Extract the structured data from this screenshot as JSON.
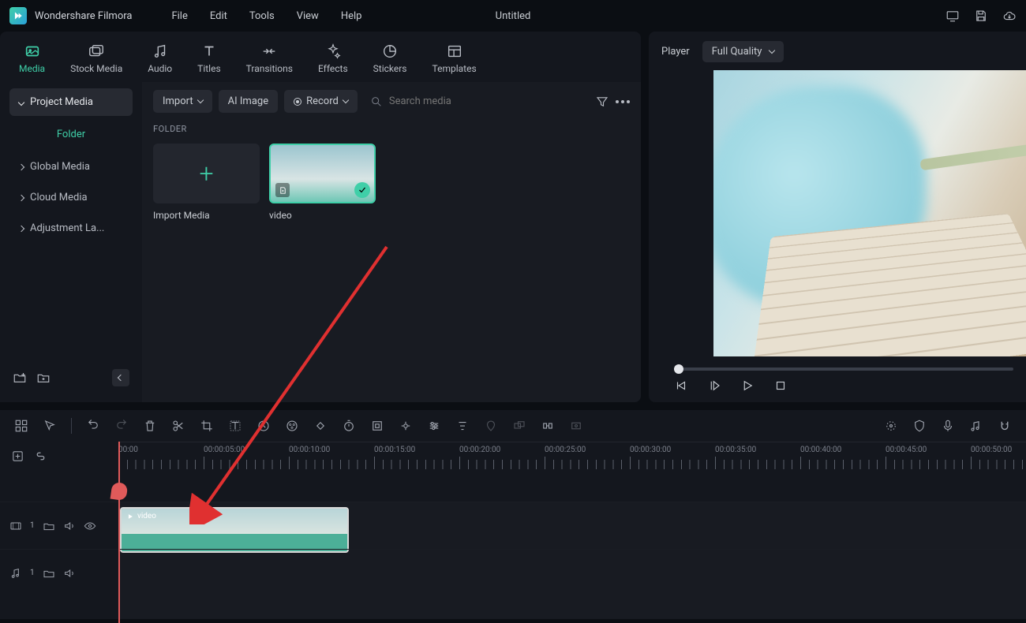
{
  "app": {
    "title": "Wondershare Filmora",
    "project": "Untitled"
  },
  "menu": [
    "File",
    "Edit",
    "Tools",
    "View",
    "Help"
  ],
  "tabs": [
    {
      "id": "media",
      "label": "Media"
    },
    {
      "id": "stock",
      "label": "Stock Media"
    },
    {
      "id": "audio",
      "label": "Audio"
    },
    {
      "id": "titles",
      "label": "Titles"
    },
    {
      "id": "transitions",
      "label": "Transitions"
    },
    {
      "id": "effects",
      "label": "Effects"
    },
    {
      "id": "stickers",
      "label": "Stickers"
    },
    {
      "id": "templates",
      "label": "Templates"
    }
  ],
  "sidebar": {
    "items": [
      {
        "label": "Project Media",
        "selected": true
      },
      {
        "label": "Global Media"
      },
      {
        "label": "Cloud Media"
      },
      {
        "label": "Adjustment La..."
      }
    ],
    "folder_label": "Folder"
  },
  "toolbar": {
    "import": "Import",
    "ai_image": "AI Image",
    "record": "Record",
    "search_placeholder": "Search media"
  },
  "content": {
    "section": "FOLDER",
    "import_label": "Import Media",
    "clip_name": "video"
  },
  "player": {
    "label": "Player",
    "quality": "Full Quality"
  },
  "timeline": {
    "ticks": [
      "00:00",
      "00:00:05:00",
      "00:00:10:00",
      "00:00:15:00",
      "00:00:20:00",
      "00:00:25:00",
      "00:00:30:00",
      "00:00:35:00",
      "00:00:40:00",
      "00:00:45:00",
      "00:00:50:00"
    ],
    "tracks": {
      "video": "1",
      "audio": "1"
    },
    "clip_label": "video"
  }
}
